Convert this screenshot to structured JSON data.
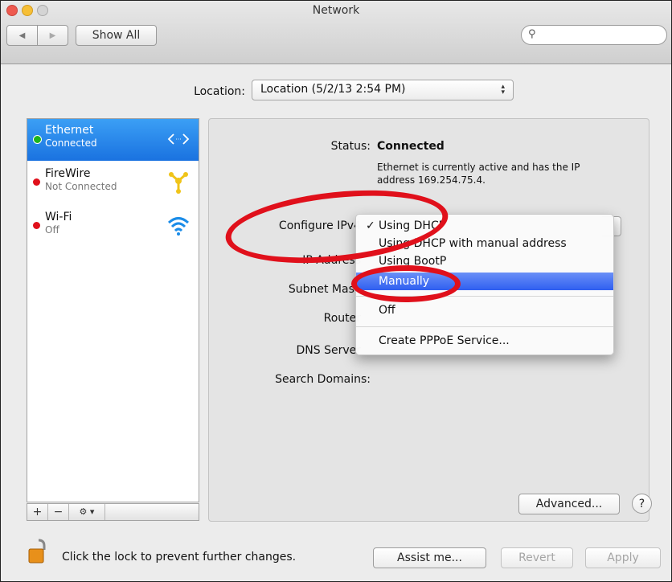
{
  "window": {
    "title": "Network"
  },
  "toolbar": {
    "show_all_label": "Show All",
    "search_placeholder": ""
  },
  "location": {
    "label": "Location:",
    "value": "Location (5/2/13 2:54 PM)"
  },
  "services": [
    {
      "name": "Ethernet",
      "status": "Connected",
      "status_color": "#1db41d",
      "icon": "ethernet-icon",
      "selected": true
    },
    {
      "name": "FireWire",
      "status": "Not Connected",
      "status_color": "#e0101b",
      "icon": "firewire-icon",
      "selected": false
    },
    {
      "name": "Wi-Fi",
      "status": "Off",
      "status_color": "#e0101b",
      "icon": "wifi-icon",
      "selected": false
    }
  ],
  "sidebar_buttons": {
    "add": "+",
    "remove": "−",
    "actions": "⚙ ▾"
  },
  "details": {
    "status_label": "Status:",
    "status_value": "Connected",
    "status_desc_line1": "Ethernet is currently active and has the IP",
    "status_desc_line2": "address 169.254.75.4.",
    "configure_label": "Configure IPv4",
    "ip_label": "IP Address",
    "subnet_label": "Subnet Mask",
    "router_label": "Router",
    "dns_label": "DNS Server",
    "search_domains_label": "Search Domains:"
  },
  "configure_menu": {
    "items": [
      "Using DHCP",
      "Using DHCP with manual address",
      "Using BootP",
      "Manually",
      "Off",
      "Create PPPoE Service..."
    ],
    "checked": "Using DHCP",
    "highlighted": "Manually",
    "check_mark": "✓"
  },
  "buttons": {
    "advanced": "Advanced...",
    "help": "?",
    "assist": "Assist me...",
    "revert": "Revert",
    "apply": "Apply"
  },
  "lock": {
    "text": "Click the lock to prevent further changes."
  },
  "colors": {
    "annotation": "#e0101b",
    "selection": "#1a72e0",
    "highlight": "#2f5ff0"
  }
}
